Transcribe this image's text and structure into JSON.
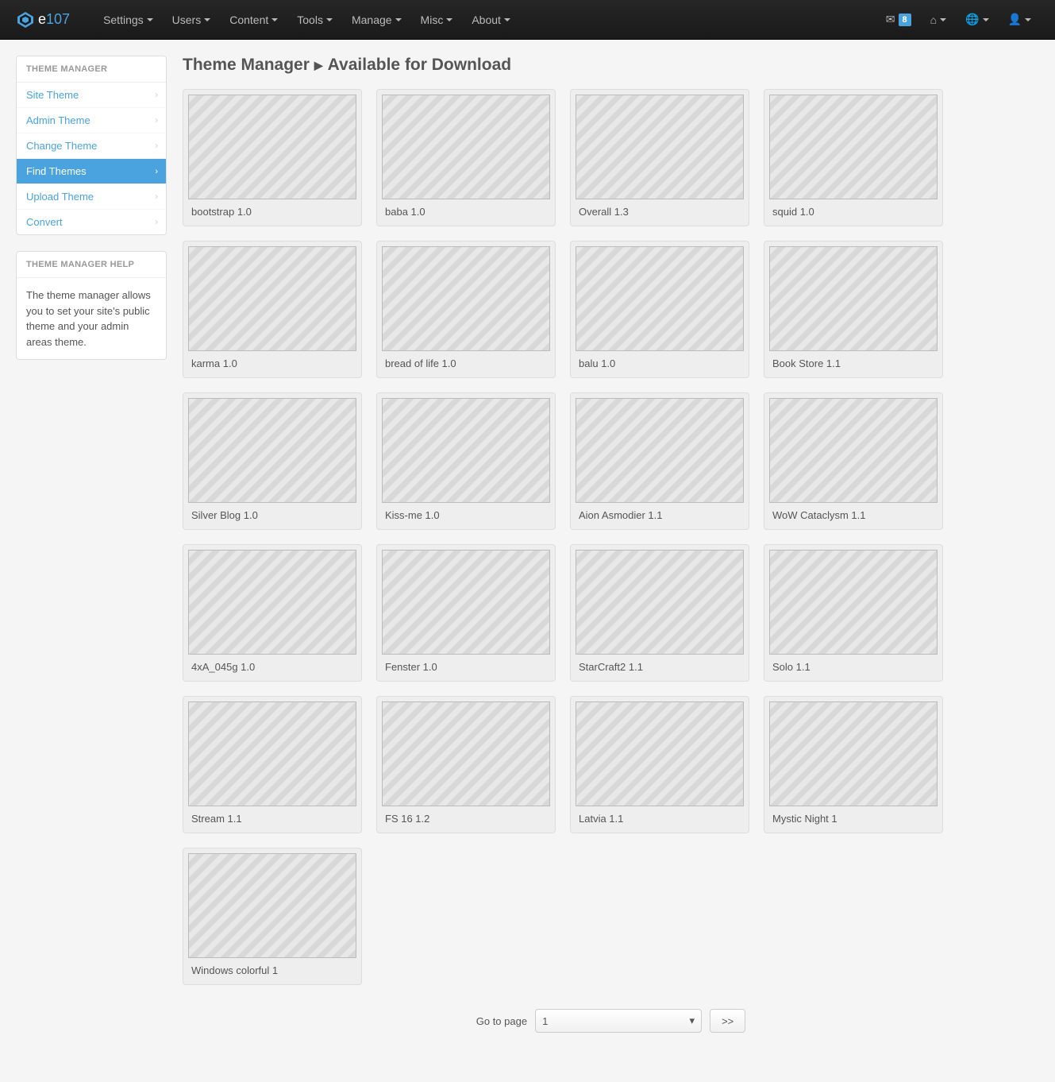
{
  "navbar": {
    "brand_e": "e",
    "brand_107": "107",
    "menu": [
      "Settings",
      "Users",
      "Content",
      "Tools",
      "Manage",
      "Misc",
      "About"
    ],
    "notifications_count": "8"
  },
  "sidebar": {
    "panel_title": "THEME MANAGER",
    "items": [
      {
        "label": "Site Theme",
        "active": false,
        "chevron": true
      },
      {
        "label": "Admin Theme",
        "active": false,
        "chevron": true
      },
      {
        "label": "Change Theme",
        "active": false,
        "chevron": true
      },
      {
        "label": "Find Themes",
        "active": true,
        "chevron": true
      },
      {
        "label": "Upload Theme",
        "active": false,
        "chevron": true
      },
      {
        "label": "Convert",
        "active": false,
        "chevron": true
      }
    ],
    "help_title": "THEME MANAGER HELP",
    "help_body": "The theme manager allows you to set your site's public theme and your admin areas theme."
  },
  "page": {
    "title_main": "Theme Manager",
    "title_sub": "Available for Download"
  },
  "themes": [
    {
      "label": "bootstrap 1.0"
    },
    {
      "label": "baba 1.0"
    },
    {
      "label": "Overall 1.3"
    },
    {
      "label": "squid 1.0"
    },
    {
      "label": "karma 1.0"
    },
    {
      "label": "bread of life 1.0"
    },
    {
      "label": "balu 1.0"
    },
    {
      "label": "Book Store 1.1"
    },
    {
      "label": "Silver Blog 1.0"
    },
    {
      "label": "Kiss-me 1.0"
    },
    {
      "label": "Aion Asmodier 1.1"
    },
    {
      "label": "WoW Cataclysm 1.1"
    },
    {
      "label": "4xA_045g 1.0"
    },
    {
      "label": "Fenster 1.0"
    },
    {
      "label": "StarCraft2 1.1"
    },
    {
      "label": "Solo 1.1"
    },
    {
      "label": "Stream 1.1"
    },
    {
      "label": "FS 16 1.2"
    },
    {
      "label": "Latvia 1.1"
    },
    {
      "label": "Mystic Night 1"
    },
    {
      "label": "Windows colorful 1"
    }
  ],
  "pager": {
    "label": "Go to page",
    "current": "1",
    "next": ">>"
  }
}
